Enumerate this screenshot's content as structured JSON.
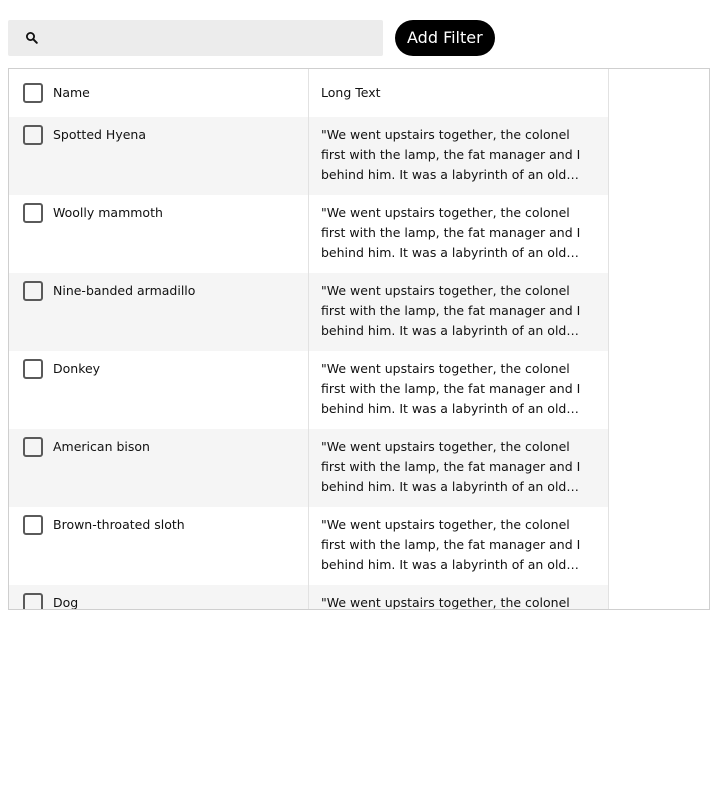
{
  "toolbar": {
    "search_value": "",
    "search_placeholder": "",
    "add_filter_label": "Add Filter"
  },
  "table": {
    "columns": [
      "Name",
      "Long Text"
    ],
    "rows": [
      {
        "name": "Spotted Hyena",
        "long_text": "\"We went upstairs together, the colonel first with the lamp, the fat manager and I behind him. It was a labyrinth of an old house, with corridors, passages, narrow winding staircases, and little low doors."
      },
      {
        "name": "Woolly mammoth",
        "long_text": "\"We went upstairs together, the colonel first with the lamp, the fat manager and I behind him. It was a labyrinth of an old house, with corridors, passages, narrow winding staircases, and little low doors."
      },
      {
        "name": "Nine-banded armadillo",
        "long_text": "\"We went upstairs together, the colonel first with the lamp, the fat manager and I behind him. It was a labyrinth of an old house, with corridors, passages, narrow winding staircases, and little low doors."
      },
      {
        "name": "Donkey",
        "long_text": "\"We went upstairs together, the colonel first with the lamp, the fat manager and I behind him. It was a labyrinth of an old house, with corridors, passages, narrow winding staircases, and little low doors."
      },
      {
        "name": "American bison",
        "long_text": "\"We went upstairs together, the colonel first with the lamp, the fat manager and I behind him. It was a labyrinth of an old house, with corridors, passages, narrow winding staircases, and little low doors."
      },
      {
        "name": "Brown-throated sloth",
        "long_text": "\"We went upstairs together, the colonel first with the lamp, the fat manager and I behind him. It was a labyrinth of an old house, with corridors, passages, narrow winding staircases, and little low doors."
      },
      {
        "name": "Dog",
        "long_text": "\"We went upstairs together, the colonel first with the lamp, the fat manager and I behind him. It was a labyrinth of an old house, with corridors, passages, narrow winding staircases, and little low doors."
      }
    ]
  },
  "icons": {
    "search": "search-icon",
    "checkbox": "checkbox-unchecked"
  },
  "colors": {
    "button_bg": "#000000",
    "button_text": "#ffffff",
    "search_bg": "#ececec",
    "row_alt_bg": "#f5f5f5",
    "border": "#cfcfcf"
  }
}
